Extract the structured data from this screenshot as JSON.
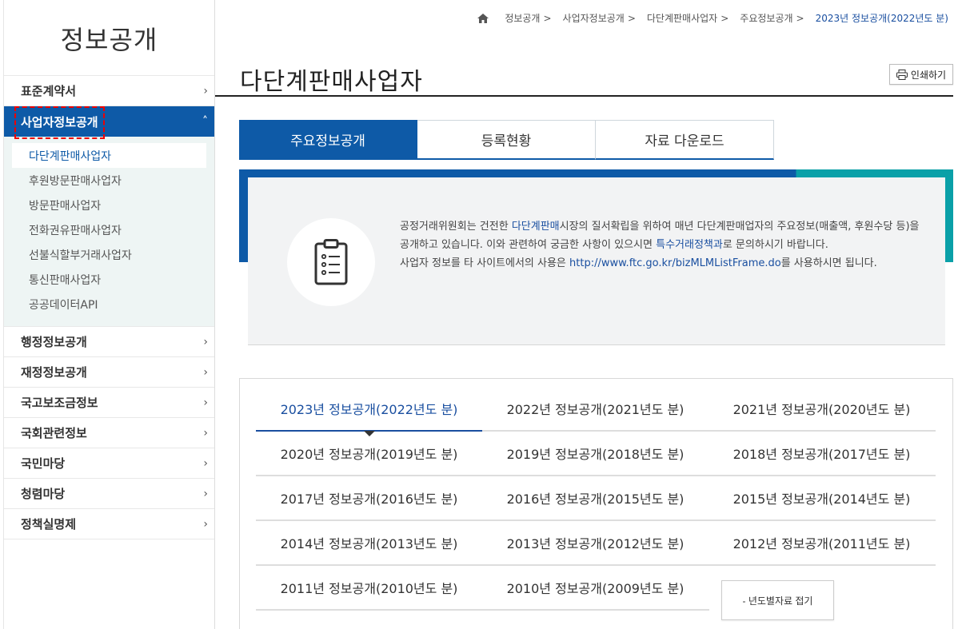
{
  "sidebar": {
    "title": "정보공개",
    "menu_before": [
      {
        "label": "표준계약서"
      }
    ],
    "active": {
      "label": "사업자정보공개",
      "submenu": [
        {
          "label": "다단계판매사업자"
        },
        {
          "label": "후원방문판매사업자"
        },
        {
          "label": "방문판매사업자"
        },
        {
          "label": "전화권유판매사업자"
        },
        {
          "label": "선불식할부거래사업자"
        },
        {
          "label": "통신판매사업자"
        },
        {
          "label": "공공데이터API"
        }
      ]
    },
    "menu_after": [
      {
        "label": "행정정보공개"
      },
      {
        "label": "재정정보공개"
      },
      {
        "label": "국고보조금정보"
      },
      {
        "label": "국회관련정보"
      },
      {
        "label": "국민마당"
      },
      {
        "label": "청렴마당"
      },
      {
        "label": "정책실명제"
      }
    ]
  },
  "breadcrumb": {
    "items": [
      "정보공개",
      "사업자정보공개",
      "다단계판매사업자",
      "주요정보공개"
    ],
    "separator": ">",
    "current": "2023년 정보공개(2022년도 분)"
  },
  "page": {
    "title": "다단계판매사업자",
    "print_label": "인쇄하기"
  },
  "tabs": [
    {
      "label": "주요정보공개"
    },
    {
      "label": "등록현황"
    },
    {
      "label": "자료 다운로드"
    }
  ],
  "info": {
    "line1_pre": "공정거래위원회는 건전한 ",
    "line1_link": "다단계판매",
    "line1_post": "시장의 질서확립을 위하여 매년 다단계판매업자의 주요정보(매출액, 후원수당 등)을 공개하고 있습니다. 이와 관련하여 궁금한 사항이 있으시면 ",
    "line1_link2": "특수거래정책과",
    "line1_end": "로 문의하시기 바랍니다.",
    "line2_pre": "사업자 정보를 타 사이트에서의 사용은 ",
    "line2_link": "http://www.ftc.go.kr/bizMLMListFrame.do",
    "line2_post": "를 사용하시면 됩니다."
  },
  "years": {
    "rows": [
      [
        "2023년 정보공개(2022년도 분)",
        "2022년 정보공개(2021년도 분)",
        "2021년 정보공개(2020년도 분)"
      ],
      [
        "2020년 정보공개(2019년도 분)",
        "2019년 정보공개(2018년도 분)",
        "2018년 정보공개(2017년도 분)"
      ],
      [
        "2017년 정보공개(2016년도 분)",
        "2016년 정보공개(2015년도 분)",
        "2015년 정보공개(2014년도 분)"
      ],
      [
        "2014년 정보공개(2013년도 분)",
        "2013년 정보공개(2012년도 분)",
        "2012년 정보공개(2011년도 분)"
      ],
      [
        "2011년 정보공개(2010년도 분)",
        "2010년 정보공개(2009년도 분)"
      ]
    ],
    "fold_label": "- 년도별자료 접기"
  },
  "colors": {
    "primary": "#0e5aa7",
    "teal": "#0aa0a8",
    "link": "#1a4fa0",
    "highlight_border": "#ee0000"
  },
  "icons": {
    "home": "home-icon",
    "printer": "printer-icon",
    "clipboard": "clipboard-icon",
    "chevron_right": "chevron-right-icon",
    "chevron_up": "chevron-up-icon"
  }
}
